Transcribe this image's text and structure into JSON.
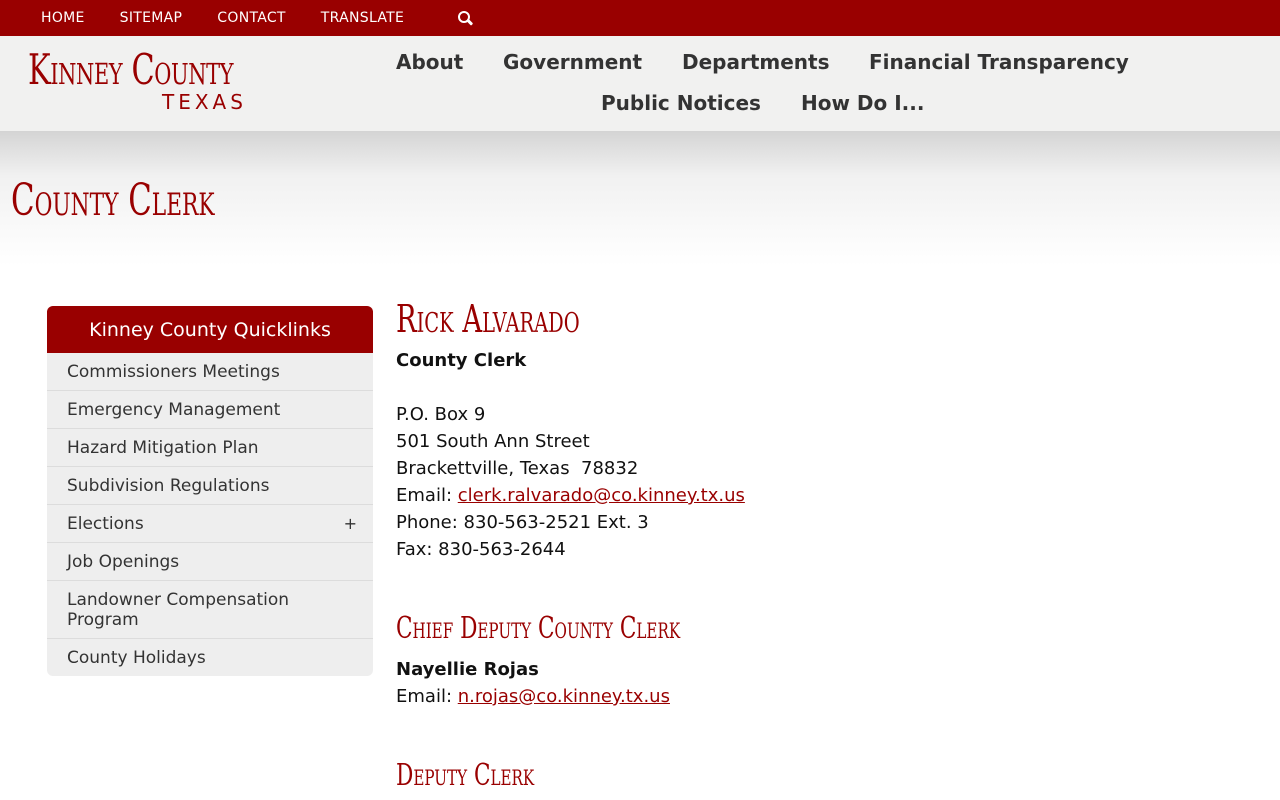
{
  "topbar": {
    "links": [
      "HOME",
      "SITEMAP",
      "CONTACT",
      "TRANSLATE"
    ],
    "search_icon": "search-icon"
  },
  "header": {
    "logo_title": "Kinney County",
    "logo_subtitle": "TEXAS",
    "nav": [
      "About",
      "Government",
      "Departments",
      "Financial Transparency",
      "Public Notices",
      "How Do I..."
    ]
  },
  "page": {
    "title": "County Clerk"
  },
  "sidebar": {
    "heading": "Kinney County Quicklinks",
    "items": [
      {
        "label": "Commissioners Meetings"
      },
      {
        "label": "Emergency Management"
      },
      {
        "label": "Hazard Mitigation Plan"
      },
      {
        "label": "Subdivision Regulations"
      },
      {
        "label": "Elections",
        "expand": "+"
      },
      {
        "label": "Job Openings"
      },
      {
        "label": "Landowner Compensation Program"
      },
      {
        "label": "County Holidays"
      }
    ]
  },
  "clerk": {
    "name": "Rick Alvarado",
    "role": "County Clerk",
    "address1": "P.O. Box 9",
    "address2": "501 South Ann Street",
    "address3": "Brackettville, Texas  78832",
    "email_label": "Email: ",
    "email": "clerk.ralvarado@co.kinney.tx.us",
    "phone": "Phone: 830-563-2521 Ext. 3",
    "fax": "Fax: 830-563-2644"
  },
  "chief_deputy": {
    "heading": "Chief Deputy County Clerk",
    "name": "Nayellie Rojas",
    "email_label": "Email: ",
    "email": "n.rojas@co.kinney.tx.us"
  },
  "deputy": {
    "heading": "Deputy Clerk"
  },
  "colors": {
    "brand": "#990000",
    "header_bg": "#f1f1f0",
    "sidebar_bg": "#eeeeee"
  }
}
